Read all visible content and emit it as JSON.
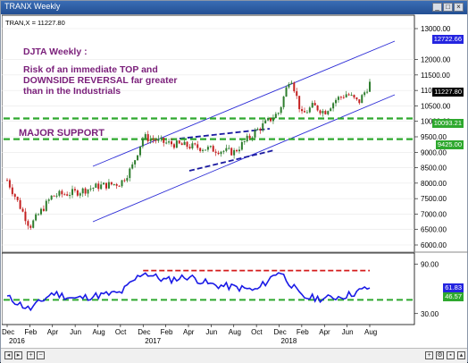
{
  "window": {
    "title": "TRANX Weekly"
  },
  "legend": {
    "symbol": "TRAN,X = 11227.80"
  },
  "annotations": {
    "heading": "DJTA Weekly :",
    "line1": "Risk of an immediate TOP and",
    "line2": "DOWNSIDE REVERSAL far greater",
    "line3": "than in the Industrials",
    "support": "MAJOR SUPPORT"
  },
  "price_axis": {
    "ticks": [
      "13000.00",
      "12000.00",
      "11500.00",
      "11000.00",
      "10500.00",
      "10000.00",
      "9500.00",
      "9000.00",
      "8500.00",
      "8000.00",
      "7500.00",
      "7000.00",
      "6500.00",
      "6000.00"
    ],
    "tags": {
      "upper_channel": "12722.66",
      "last": "11227.80",
      "support_high": "10093.21",
      "support_low": "9425.00"
    }
  },
  "indicator_axis": {
    "ticks": [
      "90.00",
      "30.00"
    ],
    "tags": {
      "last": "61.83",
      "support": "46.57"
    }
  },
  "time_axis": {
    "months": [
      "Dec",
      "Feb",
      "Apr",
      "Jun",
      "Aug",
      "Oct",
      "Dec",
      "Feb",
      "Apr",
      "Jun",
      "Aug",
      "Oct",
      "Dec",
      "Feb",
      "Apr",
      "Jun",
      "Aug"
    ],
    "years": [
      "2016",
      "2017",
      "2018"
    ]
  },
  "colors": {
    "channel": "#2b2bd6",
    "support": "#2ea82e",
    "annotation": "#7a1f7a",
    "oscillator": "#1a1ae6",
    "resistance": "#d41c1c",
    "price_up": "#2e7d2e",
    "price_down": "#c42020"
  },
  "chart_data": {
    "type": "line",
    "price": {
      "name": "TRAN,X",
      "y_axis_range": [
        6000,
        13000
      ],
      "x": [
        "2015-12",
        "2016-02",
        "2016-04",
        "2016-06",
        "2016-08",
        "2016-10",
        "2016-11",
        "2016-12",
        "2017-02",
        "2017-04",
        "2017-06",
        "2017-08",
        "2017-10",
        "2017-12",
        "2018-01",
        "2018-02",
        "2018-03",
        "2018-04",
        "2018-05",
        "2018-06",
        "2018-07",
        "2018-08"
      ],
      "y": [
        8100,
        6600,
        7600,
        7700,
        7900,
        8000,
        8500,
        9500,
        9300,
        9200,
        9100,
        9000,
        9700,
        10300,
        11500,
        10200,
        10500,
        10300,
        10700,
        10900,
        10600,
        11227.8
      ]
    },
    "support_levels": [
      10093.21,
      9425.0
    ],
    "channel_upper_last": 12722.66,
    "oscillator": {
      "y_axis_range": [
        20,
        100
      ],
      "x": [
        "2015-12",
        "2016-02",
        "2016-04",
        "2016-06",
        "2016-08",
        "2016-10",
        "2016-12",
        "2017-02",
        "2017-04",
        "2017-06",
        "2017-08",
        "2017-10",
        "2017-12",
        "2018-02",
        "2018-04",
        "2018-06",
        "2018-08"
      ],
      "y": [
        50,
        35,
        55,
        48,
        52,
        55,
        80,
        70,
        75,
        65,
        62,
        58,
        82,
        50,
        48,
        52,
        61.83
      ],
      "support_level": 46.57
    }
  }
}
